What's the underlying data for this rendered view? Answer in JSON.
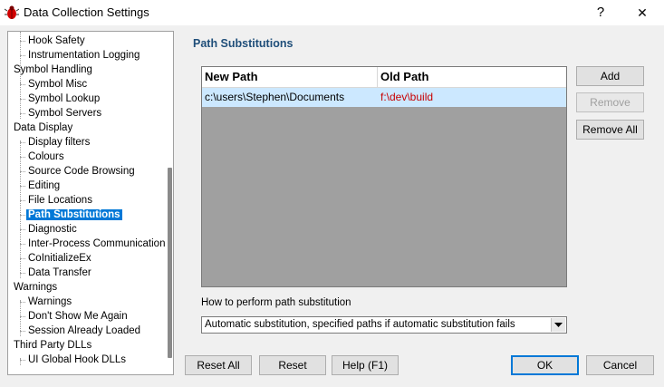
{
  "window": {
    "title": "Data Collection Settings",
    "help_label": "?",
    "close_label": "✕"
  },
  "tree": {
    "items": [
      {
        "label": "Hook Safety",
        "level": 1
      },
      {
        "label": "Instrumentation Logging",
        "level": 1
      },
      {
        "label": "Symbol Handling",
        "level": 0
      },
      {
        "label": "Symbol Misc",
        "level": 1
      },
      {
        "label": "Symbol Lookup",
        "level": 1
      },
      {
        "label": "Symbol Servers",
        "level": 1
      },
      {
        "label": "Data Display",
        "level": 0
      },
      {
        "label": "Display filters",
        "level": 1
      },
      {
        "label": "Colours",
        "level": 1
      },
      {
        "label": "Source Code Browsing",
        "level": 1
      },
      {
        "label": "Editing",
        "level": 1
      },
      {
        "label": "File Locations",
        "level": 1
      },
      {
        "label": "Path Substitutions",
        "level": 1,
        "selected": true
      },
      {
        "label": "Diagnostic",
        "level": 1
      },
      {
        "label": "Inter-Process Communication",
        "level": 1
      },
      {
        "label": "CoInitializeEx",
        "level": 1
      },
      {
        "label": "Data Transfer",
        "level": 1
      },
      {
        "label": "Warnings",
        "level": 0
      },
      {
        "label": "Warnings",
        "level": 1
      },
      {
        "label": "Don't Show Me Again",
        "level": 1
      },
      {
        "label": "Session Already Loaded",
        "level": 1
      },
      {
        "label": "Third Party DLLs",
        "level": 0
      },
      {
        "label": "UI Global Hook DLLs",
        "level": 1
      }
    ]
  },
  "panel": {
    "title": "Path Substitutions",
    "columns": [
      "New Path",
      "Old Path"
    ],
    "rows": [
      {
        "new_path": "c:\\users\\Stephen\\Documents",
        "old_path": "f:\\dev\\build"
      }
    ],
    "add_label": "Add",
    "remove_label": "Remove",
    "remove_all_label": "Remove All",
    "substitution_label": "How to perform path substitution",
    "substitution_value": "Automatic substitution, specified paths if automatic substitution fails"
  },
  "footer": {
    "reset_all_label": "Reset All",
    "reset_label": "Reset",
    "help_label": "Help (F1)",
    "ok_label": "OK",
    "cancel_label": "Cancel"
  },
  "colors": {
    "selection": "#0078d7",
    "row_highlight": "#cce8ff",
    "old_path_text": "#c80000",
    "section_title": "#1f4e79"
  }
}
